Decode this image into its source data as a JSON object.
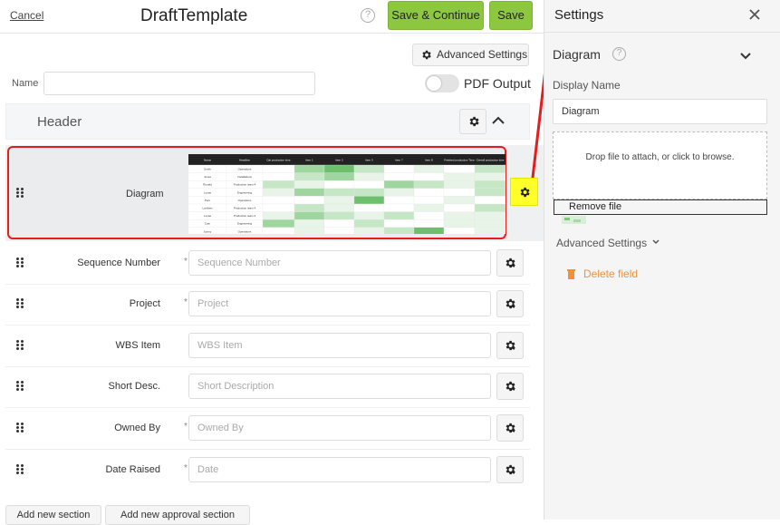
{
  "header": {
    "cancel_label": "Cancel",
    "title": "DraftTemplate",
    "help_icon": "?",
    "save_continue_label": "Save & Continue",
    "save_label": "Save"
  },
  "toolbar": {
    "advanced_settings_label": "Advanced Settings"
  },
  "form": {
    "name_label": "Name",
    "name_value": "",
    "pdf_output_label": "PDF Output",
    "pdf_output_enabled": false
  },
  "section": {
    "title": "Header"
  },
  "diagram_field": {
    "label": "Diagram",
    "preview_headers": [
      "Name",
      "Headline",
      "Dat production time",
      "Item 1",
      "Item 2",
      "Item 3",
      "Item 7",
      "Item 8",
      "Finished production Time",
      "Overall production time"
    ],
    "preview_rows": [
      [
        "Smith",
        "Operations",
        "",
        "",
        "",
        "",
        "",
        "",
        "",
        ""
      ],
      [
        "Jones",
        "Installations",
        "",
        "",
        "",
        "",
        "",
        "",
        "",
        ""
      ],
      [
        "Ronald",
        "Production team 4",
        "",
        "",
        "",
        "",
        "",
        "",
        "",
        ""
      ],
      [
        "Lucas",
        "Engineering",
        "",
        "",
        "",
        "",
        "",
        "",
        "",
        ""
      ],
      [
        "Peru",
        "Operations",
        "",
        "",
        "",
        "",
        "",
        "",
        "",
        ""
      ],
      [
        "Lambert",
        "Production team 4",
        "",
        "",
        "",
        "",
        "",
        "",
        "",
        ""
      ],
      [
        "Lucas",
        "Production team 3",
        "",
        "",
        "",
        "",
        "",
        "",
        "",
        ""
      ],
      [
        "Cain",
        "Engineering",
        "",
        "",
        "",
        "",
        "",
        "",
        "",
        ""
      ],
      [
        "Sonny",
        "Operations",
        "",
        "",
        "",
        "",
        "",
        "",
        "",
        ""
      ]
    ]
  },
  "fields": [
    {
      "label": "Sequence Number",
      "placeholder": "Sequence Number",
      "tick": "*"
    },
    {
      "label": "Project",
      "placeholder": "Project",
      "tick": "*"
    },
    {
      "label": "WBS Item",
      "placeholder": "WBS Item",
      "tick": ""
    },
    {
      "label": "Short Desc.",
      "placeholder": "Short Description",
      "tick": ""
    },
    {
      "label": "Owned By",
      "placeholder": "Owned By",
      "tick": "*"
    },
    {
      "label": "Date Raised",
      "placeholder": "Date",
      "tick": "*"
    }
  ],
  "footer": {
    "add_section_label": "Add new section",
    "add_approval_label": "Add new approval section"
  },
  "settings": {
    "title": "Settings",
    "field_heading": "Diagram",
    "display_name_label": "Display Name",
    "display_name_value": "Diagram",
    "dropzone_text": "Drop file to attach, or click to browse.",
    "remove_file_label": "Remove file",
    "advanced_settings_label": "Advanced Settings",
    "delete_field_label": "Delete field"
  },
  "colors": {
    "primary_green": "#8dc63f",
    "highlight_yellow": "#ffff29",
    "selection_red": "#e51c1c",
    "delete_orange": "#f0913a"
  }
}
